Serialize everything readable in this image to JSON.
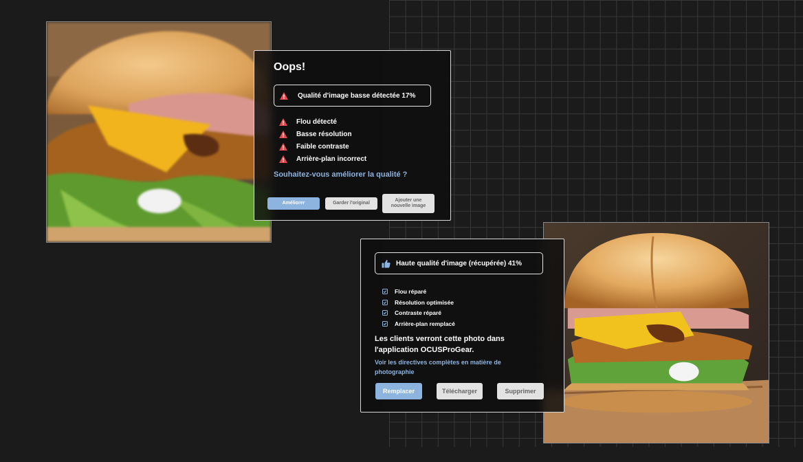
{
  "colors": {
    "background": "#1b1b1b",
    "accent": "#8db3df",
    "warning": "#e5484d",
    "button_light": "#e2e2e2"
  },
  "oops_dialog": {
    "title": "Oops!",
    "quality_badge": {
      "icon": "warning-icon",
      "text": "Qualité d'image basse détectée 17%"
    },
    "issues": [
      {
        "icon": "warning-icon",
        "label": "Flou détecté"
      },
      {
        "icon": "warning-icon",
        "label": "Basse résolution"
      },
      {
        "icon": "warning-icon",
        "label": "Faible contraste"
      },
      {
        "icon": "warning-icon",
        "label": "Arrière-plan incorrect"
      }
    ],
    "question": "Souhaitez-vous améliorer la qualité ?",
    "buttons": {
      "improve": "Améliorer",
      "keep_original": "Garder l'original",
      "add_new_image": "Ajouter une nouvelle image"
    }
  },
  "recovered_dialog": {
    "quality_badge": {
      "icon": "thumbs-up-icon",
      "text": "Haute qualité d'image (récupérée) 41%"
    },
    "fixes": [
      {
        "icon": "checkbox-icon",
        "label": "Flou réparé"
      },
      {
        "icon": "checkbox-icon",
        "label": "Résolution optimisée"
      },
      {
        "icon": "checkbox-icon",
        "label": "Contraste réparé"
      },
      {
        "icon": "checkbox-icon",
        "label": "Arrière-plan remplacé"
      }
    ],
    "message": "Les clients verront cette photo dans l'application OCUSProGear.",
    "guidelines_link": "Voir les directives complètes en matière de photographie",
    "buttons": {
      "replace": "Remplacer",
      "download": "Télécharger",
      "delete": "Supprimer"
    }
  }
}
